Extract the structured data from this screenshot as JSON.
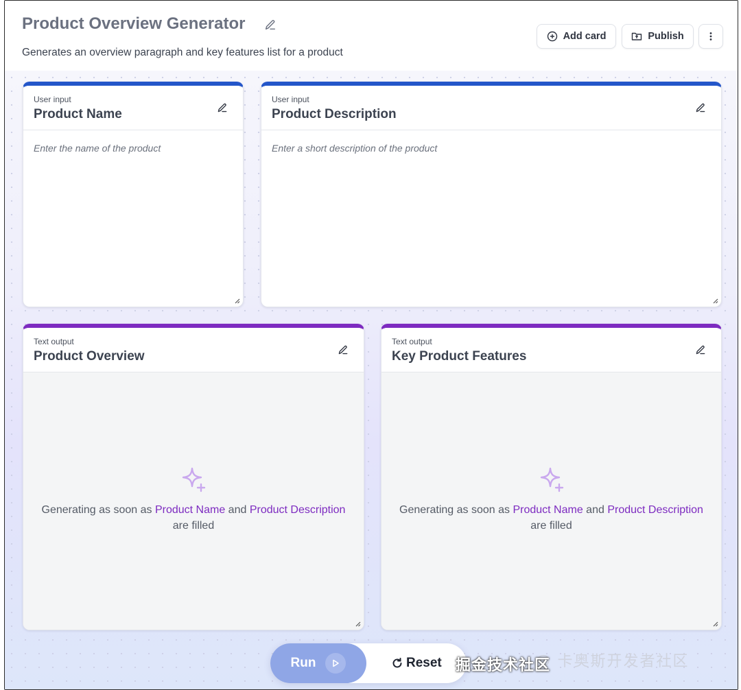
{
  "header": {
    "title": "Product Overview Generator",
    "subtitle": "Generates an overview paragraph and key features list for a product",
    "add_card_label": "Add card",
    "publish_label": "Publish"
  },
  "cards": {
    "product_name": {
      "kind": "User input",
      "title": "Product Name",
      "placeholder": "Enter the name of the product"
    },
    "product_description": {
      "kind": "User input",
      "title": "Product Description",
      "placeholder": "Enter a short description of the product"
    },
    "product_overview": {
      "kind": "Text output",
      "title": "Product Overview",
      "msg_prefix": "Generating as soon as ",
      "ref1": "Product Name",
      "msg_and": " and ",
      "ref2": "Product Description",
      "msg_suffix": "are filled"
    },
    "key_features": {
      "kind": "Text output",
      "title": "Key Product Features",
      "msg_prefix": "Generating as soon as ",
      "ref1": "Product Name",
      "msg_and": " and ",
      "ref2": "Product Description",
      "msg_suffix": "are filled"
    }
  },
  "runbar": {
    "run_label": "Run",
    "reset_label": "Reset"
  },
  "watermark": {
    "left": "掘金技术社区",
    "right": "@ 卡奥斯开发者社区"
  },
  "colors": {
    "input_accent": "#2456c9",
    "output_accent": "#7d2bc0",
    "run_button": "#8fa6e6"
  }
}
